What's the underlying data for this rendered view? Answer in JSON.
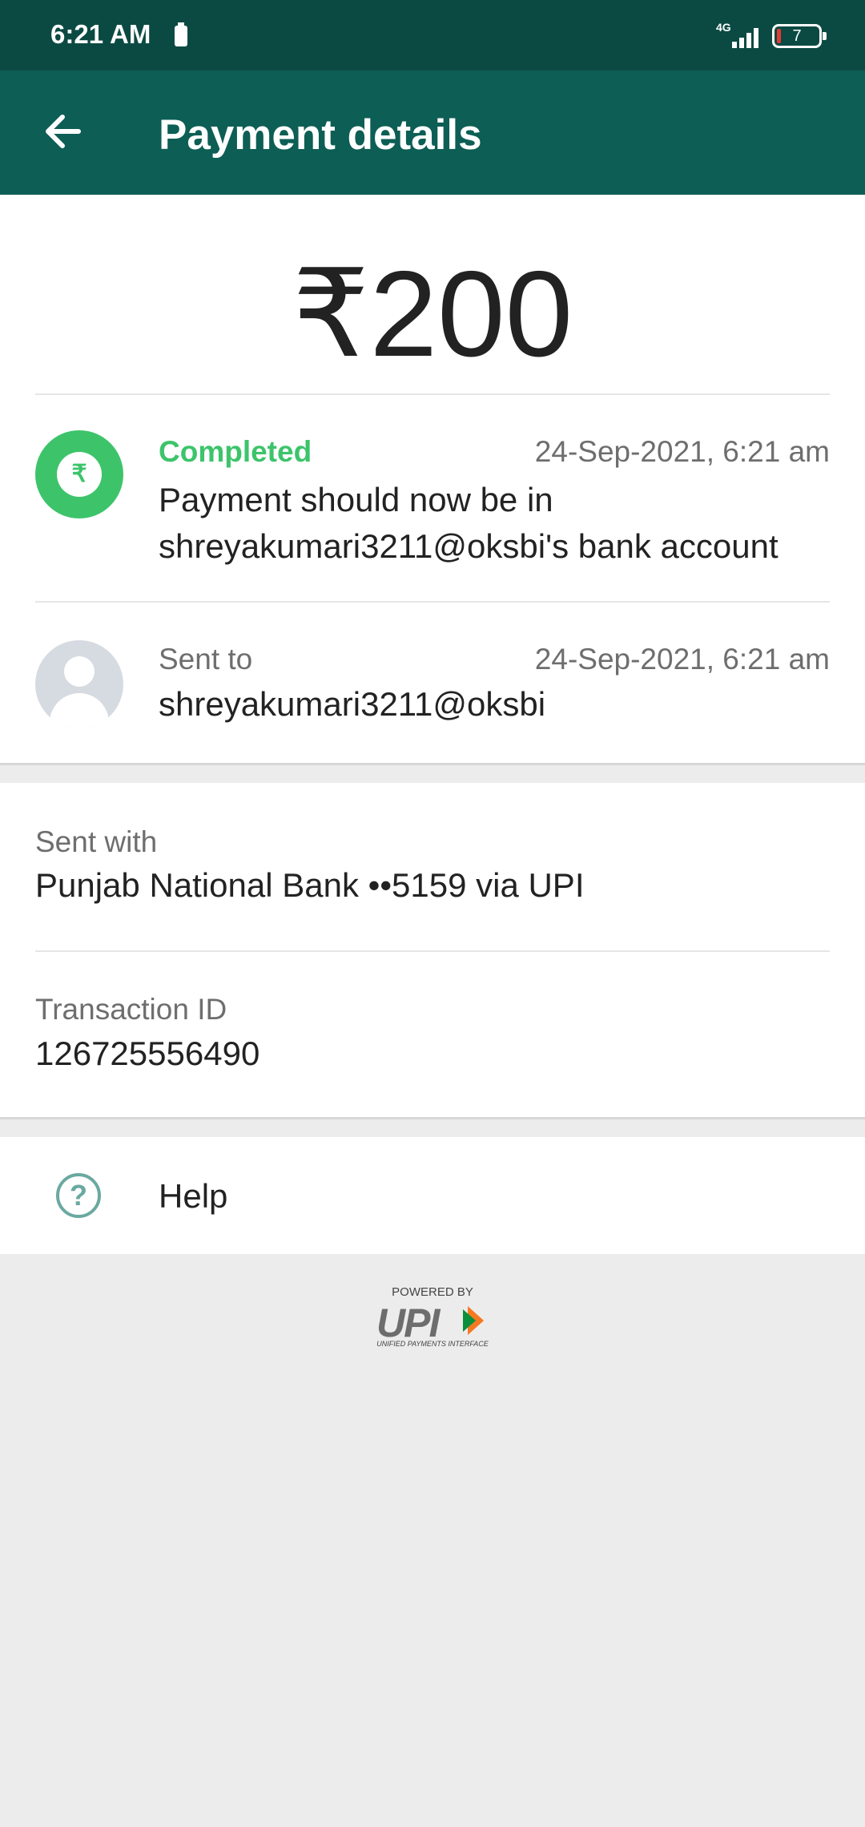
{
  "status_bar": {
    "time": "6:21 AM",
    "network": "4G",
    "battery": "7"
  },
  "app_bar": {
    "title": "Payment details"
  },
  "payment": {
    "amount": "₹200",
    "status_label": "Completed",
    "status_date": "24-Sep-2021, 6:21 am",
    "status_message": "Payment should now be in shreyakumari3211@oksbi's bank account",
    "currency_symbol": "₹",
    "sent_to_label": "Sent to",
    "sent_to_date": "24-Sep-2021, 6:21 am",
    "sent_to_value": "shreyakumari3211@oksbi"
  },
  "details": {
    "sent_with_label": "Sent with",
    "sent_with_value": "Punjab National Bank ••5159 via UPI",
    "transaction_label": "Transaction ID",
    "transaction_value": "126725556490"
  },
  "help": {
    "label": "Help",
    "icon": "?"
  },
  "footer": {
    "powered_by": "POWERED BY",
    "logo_text": "UPI",
    "logo_subtitle": "UNIFIED PAYMENTS INTERFACE"
  },
  "colors": {
    "status_bar": "#0b4a43",
    "app_bar": "#0d5e55",
    "success": "#3dc46b",
    "help_icon": "#6aa9a0"
  }
}
